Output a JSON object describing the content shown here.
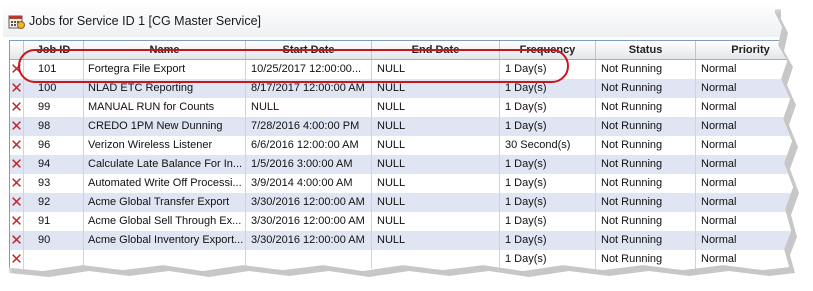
{
  "window": {
    "title": "Jobs for Service ID 1 [CG Master Service]"
  },
  "columns": [
    "",
    "Job ID",
    "Name",
    "Start Date",
    "End Date",
    "Frequency",
    "Status",
    "Priority"
  ],
  "rows": [
    {
      "job_id": "101",
      "name": "Fortegra File Export",
      "start_date": "10/25/2017  12:00:00...",
      "end_date": "NULL",
      "frequency": "1 Day(s)",
      "status": "Not Running",
      "priority": "Normal"
    },
    {
      "job_id": "100",
      "name": "NLAD ETC Reporting",
      "start_date": "8/17/2017 12:00:00 AM",
      "end_date": "NULL",
      "frequency": "1 Day(s)",
      "status": "Not Running",
      "priority": "Normal"
    },
    {
      "job_id": "99",
      "name": "MANUAL RUN for Counts",
      "start_date": "NULL",
      "end_date": "NULL",
      "frequency": "1 Day(s)",
      "status": "Not Running",
      "priority": "Normal"
    },
    {
      "job_id": "98",
      "name": "CREDO 1PM New Dunning",
      "start_date": "7/28/2016 4:00:00 PM",
      "end_date": "NULL",
      "frequency": "1 Day(s)",
      "status": "Not Running",
      "priority": "Normal"
    },
    {
      "job_id": "96",
      "name": "Verizon Wireless Listener",
      "start_date": "6/6/2016 12:00:00 AM",
      "end_date": "NULL",
      "frequency": "30 Second(s)",
      "status": "Not Running",
      "priority": "Normal"
    },
    {
      "job_id": "94",
      "name": "Calculate Late Balance For In...",
      "start_date": "1/5/2016 3:00:00 AM",
      "end_date": "NULL",
      "frequency": "1 Day(s)",
      "status": "Not Running",
      "priority": "Normal"
    },
    {
      "job_id": "93",
      "name": "Automated Write Off Processi...",
      "start_date": "3/9/2014 4:00:00 AM",
      "end_date": "NULL",
      "frequency": "1 Day(s)",
      "status": "Not Running",
      "priority": "Normal"
    },
    {
      "job_id": "92",
      "name": "Acme Global Transfer Export",
      "start_date": "3/30/2016 12:00:00 AM",
      "end_date": "NULL",
      "frequency": "1 Day(s)",
      "status": "Not Running",
      "priority": "Normal"
    },
    {
      "job_id": "91",
      "name": "Acme Global Sell Through Ex...",
      "start_date": "3/30/2016 12:00:00 AM",
      "end_date": "NULL",
      "frequency": "1 Day(s)",
      "status": "Not Running",
      "priority": "Normal"
    },
    {
      "job_id": "90",
      "name": "Acme Global Inventory Export...",
      "start_date": "3/30/2016 12:00:00 AM",
      "end_date": "NULL",
      "frequency": "1 Day(s)",
      "status": "Not Running",
      "priority": "Normal"
    },
    {
      "job_id": "",
      "name": "",
      "start_date": "",
      "end_date": "",
      "frequency": "1 Day(s)",
      "status": "Not Running",
      "priority": "Normal"
    }
  ],
  "icons": {
    "row_status": "red-x-icon",
    "window": "calendar-app-icon"
  },
  "colors": {
    "highlight": "#c8161e",
    "alt_row": "#dfe5f2",
    "x_mark": "#c1272d"
  }
}
